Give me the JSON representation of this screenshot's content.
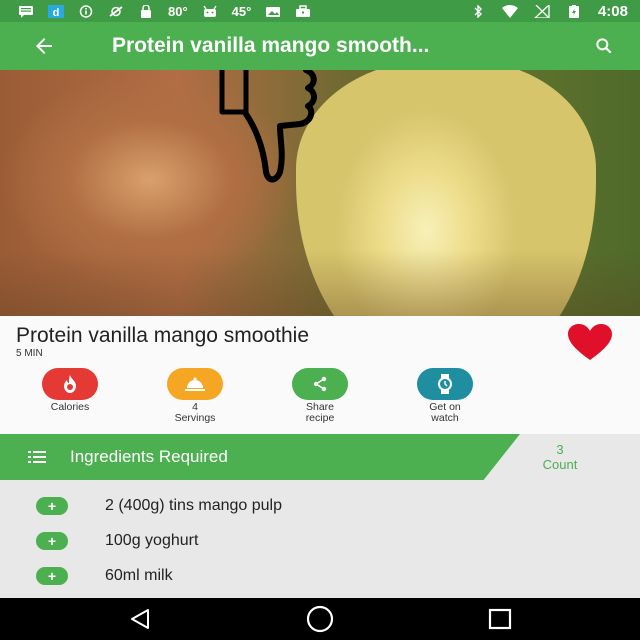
{
  "status_bar": {
    "icons_left": [
      "message-icon",
      "d-app-icon",
      "info-icon",
      "no-location-icon",
      "lock-icon",
      "android-icon",
      "android-icon",
      "photo-icon",
      "briefcase-icon"
    ],
    "temp1": "80°",
    "temp2": "45°",
    "icons_right": [
      "bluetooth-icon",
      "wifi-icon",
      "signal-icon",
      "battery-icon"
    ],
    "time": "4:08"
  },
  "app_bar": {
    "title": "Protein vanilla mango smooth...",
    "back_icon": "arrow-back-icon",
    "search_icon": "search-icon"
  },
  "hero": {
    "overlay_icon": "thumbs-down-icon"
  },
  "recipe": {
    "title": "Protein vanilla mango smoothie",
    "time": "5 MIN",
    "favorite_icon": "heart-icon"
  },
  "actions": [
    {
      "label": "Calories",
      "icon": "flame-icon",
      "color": "#e53935"
    },
    {
      "label": "4\nServings",
      "icon": "cloche-icon",
      "color": "#f5a623"
    },
    {
      "label": "Share\nrecipe",
      "icon": "share-icon",
      "color": "#4caf50"
    },
    {
      "label": "Get on\nwatch",
      "icon": "watch-icon",
      "color": "#1e8ea0"
    }
  ],
  "ingredients": {
    "header": "Ingredients Required",
    "count_value": "3",
    "count_label": "Count",
    "items": [
      "2 (400g) tins mango pulp",
      "100g yoghurt",
      "60ml milk"
    ]
  },
  "colors": {
    "primary": "#4caf50",
    "status_bar": "#3f9b45",
    "heart": "#e0102a"
  }
}
